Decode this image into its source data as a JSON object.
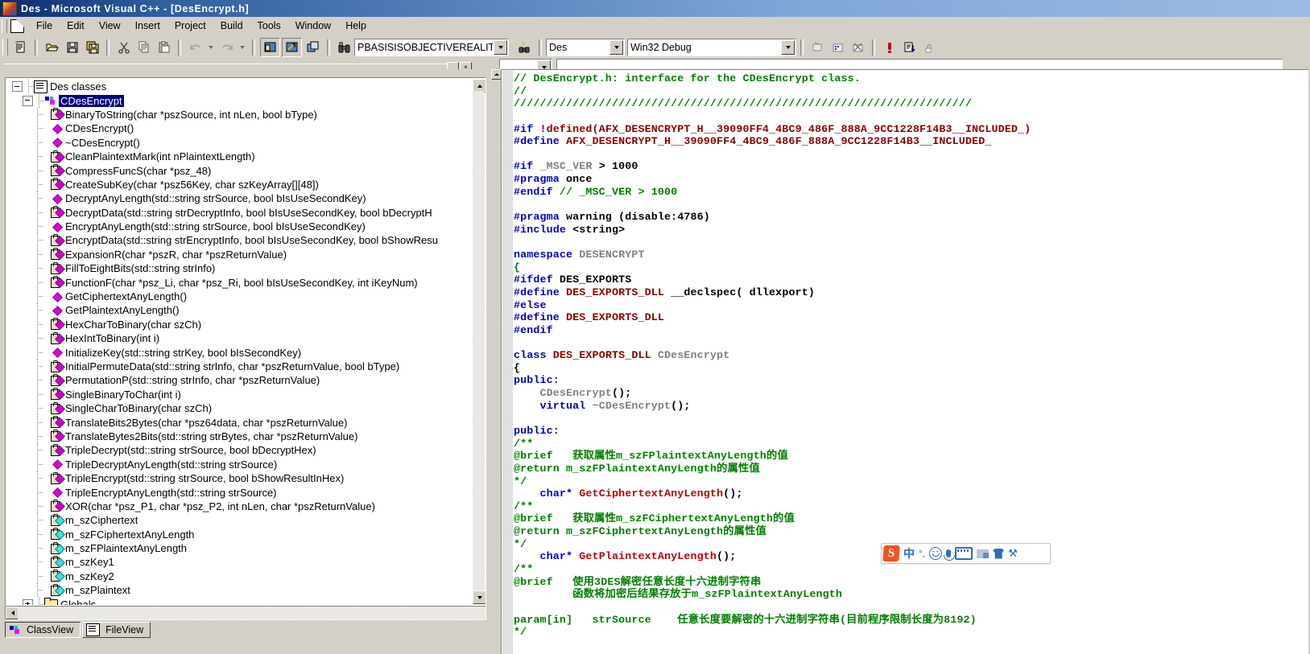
{
  "window": {
    "title": "Des - Microsoft Visual C++ - [DesEncrypt.h]",
    "app_icon": "visual-cpp-icon"
  },
  "menubar": {
    "doc_icon": "document-icon",
    "items": [
      {
        "label": "File"
      },
      {
        "label": "Edit"
      },
      {
        "label": "View"
      },
      {
        "label": "Insert"
      },
      {
        "label": "Project"
      },
      {
        "label": "Build"
      },
      {
        "label": "Tools"
      },
      {
        "label": "Window"
      },
      {
        "label": "Help"
      }
    ]
  },
  "toolbar_standard": {
    "buttons": [
      {
        "name": "new-text-file-icon",
        "title": "New"
      },
      {
        "name": "open-folder-icon",
        "title": "Open"
      },
      {
        "name": "save-icon",
        "title": "Save"
      },
      {
        "name": "save-all-icon",
        "title": "Save All"
      },
      {
        "name": "cut-scissors-icon",
        "title": "Cut"
      },
      {
        "name": "copy-icon",
        "title": "Copy"
      },
      {
        "name": "paste-icon",
        "title": "Paste"
      },
      {
        "name": "undo-icon",
        "title": "Undo"
      },
      {
        "name": "undo-dropdown-icon",
        "title": "Undo list"
      },
      {
        "name": "redo-icon",
        "title": "Redo"
      },
      {
        "name": "redo-dropdown-icon",
        "title": "Redo list"
      },
      {
        "name": "workspace-window-icon",
        "title": "Workspace"
      },
      {
        "name": "output-window-icon",
        "title": "Output"
      },
      {
        "name": "window-list-icon",
        "title": "Windows"
      }
    ],
    "find_icon": "binoculars-icon",
    "find_value": "PBASISISOBJECTIVEREALIT",
    "find_in_files_icon": "find-in-files-icon",
    "project_value": "Des",
    "config_value": "Win32 Debug",
    "build_buttons": [
      {
        "name": "compile-icon",
        "title": "Compile"
      },
      {
        "name": "build-icon",
        "title": "Build"
      },
      {
        "name": "stop-build-icon",
        "title": "Stop Build"
      },
      {
        "name": "execute-program-icon",
        "title": "Execute Program"
      },
      {
        "name": "go-debug-icon",
        "title": "Go"
      },
      {
        "name": "insert-breakpoint-icon",
        "title": "Insert/Remove Breakpoint"
      }
    ]
  },
  "toolbar_wizard": {
    "combo_value": "",
    "search_value": ""
  },
  "pane_buttons": {
    "minimize_label": "_",
    "close_label": "×"
  },
  "classview": {
    "tabs": [
      {
        "label": "ClassView",
        "icon": "classview-icon",
        "active": true
      },
      {
        "label": "FileView",
        "icon": "fileview-icon",
        "active": false
      }
    ],
    "tree": [
      {
        "label": "Des classes",
        "icon": "classes-root-icon",
        "depth": 0,
        "toggle": "minus",
        "selected": false
      },
      {
        "label": "CDesEncrypt",
        "icon": "class-icon",
        "depth": 1,
        "toggle": "minus",
        "selected": true
      },
      {
        "label": "BinaryToString(char *pszSource, int nLen, bool bType)",
        "icon": "protected-method-icon",
        "depth": 2,
        "toggle": "none",
        "selected": false
      },
      {
        "label": "CDesEncrypt()",
        "icon": "public-method-icon",
        "depth": 2,
        "toggle": "none",
        "selected": false
      },
      {
        "label": "~CDesEncrypt()",
        "icon": "public-method-icon",
        "depth": 2,
        "toggle": "none",
        "selected": false
      },
      {
        "label": "CleanPlaintextMark(int nPlaintextLength)",
        "icon": "protected-method-icon",
        "depth": 2,
        "toggle": "none",
        "selected": false
      },
      {
        "label": "CompressFuncS(char *psz_48)",
        "icon": "protected-method-icon",
        "depth": 2,
        "toggle": "none",
        "selected": false
      },
      {
        "label": "CreateSubKey(char *psz56Key, char szKeyArray[][48])",
        "icon": "protected-method-icon",
        "depth": 2,
        "toggle": "none",
        "selected": false
      },
      {
        "label": "DecryptAnyLength(std::string strSource, bool bIsUseSecondKey)",
        "icon": "public-method-icon",
        "depth": 2,
        "toggle": "none",
        "selected": false
      },
      {
        "label": "DecryptData(std::string strDecryptInfo, bool bIsUseSecondKey, bool bDecryptH",
        "icon": "protected-method-icon",
        "depth": 2,
        "toggle": "none",
        "selected": false
      },
      {
        "label": "EncryptAnyLength(std::string strSource, bool bIsUseSecondKey)",
        "icon": "public-method-icon",
        "depth": 2,
        "toggle": "none",
        "selected": false
      },
      {
        "label": "EncryptData(std::string strEncryptInfo, bool bIsUseSecondKey, bool bShowResu",
        "icon": "protected-method-icon",
        "depth": 2,
        "toggle": "none",
        "selected": false
      },
      {
        "label": "ExpansionR(char *pszR, char *pszReturnValue)",
        "icon": "protected-method-icon",
        "depth": 2,
        "toggle": "none",
        "selected": false
      },
      {
        "label": "FillToEightBits(std::string strInfo)",
        "icon": "protected-method-icon",
        "depth": 2,
        "toggle": "none",
        "selected": false
      },
      {
        "label": "FunctionF(char *psz_Li, char *psz_Ri, bool bIsUseSecondKey, int iKeyNum)",
        "icon": "protected-method-icon",
        "depth": 2,
        "toggle": "none",
        "selected": false
      },
      {
        "label": "GetCiphertextAnyLength()",
        "icon": "public-method-icon",
        "depth": 2,
        "toggle": "none",
        "selected": false
      },
      {
        "label": "GetPlaintextAnyLength()",
        "icon": "public-method-icon",
        "depth": 2,
        "toggle": "none",
        "selected": false
      },
      {
        "label": "HexCharToBinary(char szCh)",
        "icon": "protected-method-icon",
        "depth": 2,
        "toggle": "none",
        "selected": false
      },
      {
        "label": "HexIntToBinary(int i)",
        "icon": "protected-method-icon",
        "depth": 2,
        "toggle": "none",
        "selected": false
      },
      {
        "label": "InitializeKey(std::string strKey, bool bIsSecondKey)",
        "icon": "public-method-icon",
        "depth": 2,
        "toggle": "none",
        "selected": false
      },
      {
        "label": "InitialPermuteData(std::string strInfo, char *pszReturnValue, bool bType)",
        "icon": "protected-method-icon",
        "depth": 2,
        "toggle": "none",
        "selected": false
      },
      {
        "label": "PermutationP(std::string strInfo, char *pszReturnValue)",
        "icon": "protected-method-icon",
        "depth": 2,
        "toggle": "none",
        "selected": false
      },
      {
        "label": "SingleBinaryToChar(int i)",
        "icon": "protected-method-icon",
        "depth": 2,
        "toggle": "none",
        "selected": false
      },
      {
        "label": "SingleCharToBinary(char szCh)",
        "icon": "protected-method-icon",
        "depth": 2,
        "toggle": "none",
        "selected": false
      },
      {
        "label": "TranslateBits2Bytes(char *psz64data, char *pszReturnValue)",
        "icon": "protected-method-icon",
        "depth": 2,
        "toggle": "none",
        "selected": false
      },
      {
        "label": "TranslateBytes2Bits(std::string strBytes, char *pszReturnValue)",
        "icon": "protected-method-icon",
        "depth": 2,
        "toggle": "none",
        "selected": false
      },
      {
        "label": "TripleDecrypt(std::string strSource, bool bDecryptHex)",
        "icon": "protected-method-icon",
        "depth": 2,
        "toggle": "none",
        "selected": false
      },
      {
        "label": "TripleDecryptAnyLength(std::string strSource)",
        "icon": "public-method-icon",
        "depth": 2,
        "toggle": "none",
        "selected": false
      },
      {
        "label": "TripleEncrypt(std::string strSource, bool bShowResultInHex)",
        "icon": "protected-method-icon",
        "depth": 2,
        "toggle": "none",
        "selected": false
      },
      {
        "label": "TripleEncryptAnyLength(std::string strSource)",
        "icon": "public-method-icon",
        "depth": 2,
        "toggle": "none",
        "selected": false
      },
      {
        "label": "XOR(char *psz_P1, char *psz_P2, int nLen, char *pszReturnValue)",
        "icon": "protected-method-icon",
        "depth": 2,
        "toggle": "none",
        "selected": false
      },
      {
        "label": "m_szCiphertext",
        "icon": "member-variable-icon",
        "depth": 2,
        "toggle": "none",
        "selected": false
      },
      {
        "label": "m_szFCiphertextAnyLength",
        "icon": "member-variable-icon",
        "depth": 2,
        "toggle": "none",
        "selected": false
      },
      {
        "label": "m_szFPlaintextAnyLength",
        "icon": "member-variable-icon",
        "depth": 2,
        "toggle": "none",
        "selected": false
      },
      {
        "label": "m_szKey1",
        "icon": "member-variable-icon",
        "depth": 2,
        "toggle": "none",
        "selected": false
      },
      {
        "label": "m_szKey2",
        "icon": "member-variable-icon",
        "depth": 2,
        "toggle": "none",
        "selected": false
      },
      {
        "label": "m_szPlaintext",
        "icon": "member-variable-icon",
        "depth": 2,
        "toggle": "none",
        "selected": false
      },
      {
        "label": "Globals",
        "icon": "folder-icon",
        "depth": 1,
        "toggle": "plus",
        "selected": false
      }
    ]
  },
  "editor": {
    "filename": "DesEncrypt.h",
    "lines": [
      [
        {
          "t": "// DesEncrypt.h: interface for the CDesEncrypt class.",
          "c": "c-com"
        }
      ],
      [
        {
          "t": "//",
          "c": "c-com"
        }
      ],
      [
        {
          "t": "//////////////////////////////////////////////////////////////////////",
          "c": "c-com"
        }
      ],
      [],
      [
        {
          "t": "#if",
          "c": "c-pre"
        },
        {
          "t": " !defined(AFX_DESENCRYPT_H__39090FF4_4BC9_486F_888A_9CC1228F14B3__INCLUDED_)",
          "c": "c-def"
        }
      ],
      [
        {
          "t": "#define",
          "c": "c-pre"
        },
        {
          "t": " AFX_DESENCRYPT_H__39090FF4_4BC9_486F_888A_9CC1228F14B3__INCLUDED_",
          "c": "c-def"
        }
      ],
      [],
      [
        {
          "t": "#if",
          "c": "c-pre"
        },
        {
          "t": " _MSC_VER",
          "c": "c-id"
        },
        {
          "t": " > ",
          "c": "c-blk"
        },
        {
          "t": "1000",
          "c": "c-num"
        }
      ],
      [
        {
          "t": "#pragma",
          "c": "c-pre"
        },
        {
          "t": " once",
          "c": "c-blk"
        }
      ],
      [
        {
          "t": "#endif",
          "c": "c-pre"
        },
        {
          "t": " // _MSC_VER > 1000",
          "c": "c-com"
        }
      ],
      [],
      [
        {
          "t": "#pragma",
          "c": "c-pre"
        },
        {
          "t": " warning (disable:4786)",
          "c": "c-blk"
        }
      ],
      [
        {
          "t": "#include",
          "c": "c-pre"
        },
        {
          "t": " <string>",
          "c": "c-blk"
        }
      ],
      [],
      [
        {
          "t": "namespace",
          "c": "c-kw"
        },
        {
          "t": " DESENCRYPT",
          "c": "c-id"
        }
      ],
      [
        {
          "t": "{",
          "c": "c-com"
        }
      ],
      [
        {
          "t": "#ifdef",
          "c": "c-pre"
        },
        {
          "t": " DES_EXPORTS",
          "c": "c-blk"
        }
      ],
      [
        {
          "t": "#define",
          "c": "c-pre"
        },
        {
          "t": " DES_EXPORTS_DLL",
          "c": "c-def"
        },
        {
          "t": " __declspec( dllexport)",
          "c": "c-blk"
        }
      ],
      [
        {
          "t": "#else",
          "c": "c-pre"
        }
      ],
      [
        {
          "t": "#define",
          "c": "c-pre"
        },
        {
          "t": " DES_EXPORTS_DLL",
          "c": "c-def"
        }
      ],
      [
        {
          "t": "#endif",
          "c": "c-pre"
        }
      ],
      [],
      [
        {
          "t": "class",
          "c": "c-kw"
        },
        {
          "t": " DES_EXPORTS_DLL",
          "c": "c-def"
        },
        {
          "t": " CDesEncrypt",
          "c": "c-id"
        }
      ],
      [
        {
          "t": "{",
          "c": "c-blk"
        }
      ],
      [
        {
          "t": "public:",
          "c": "c-kw"
        }
      ],
      [
        {
          "t": "    CDesEncrypt",
          "c": "c-id"
        },
        {
          "t": "();",
          "c": "c-blk"
        }
      ],
      [
        {
          "t": "    virtual",
          "c": "c-kw"
        },
        {
          "t": " ~CDesEncrypt",
          "c": "c-id"
        },
        {
          "t": "();",
          "c": "c-blk"
        }
      ],
      [],
      [
        {
          "t": "public:",
          "c": "c-kw"
        }
      ],
      [
        {
          "t": "/**",
          "c": "c-com"
        }
      ],
      [
        {
          "t": "@brief   获取属性m_szFPlaintextAnyLength的值",
          "c": "c-com"
        }
      ],
      [
        {
          "t": "@return m_szFPlaintextAnyLength的属性值",
          "c": "c-com"
        }
      ],
      [
        {
          "t": "*/",
          "c": "c-com"
        }
      ],
      [
        {
          "t": "    char*",
          "c": "c-kw"
        },
        {
          "t": " GetCiphertextAnyLength",
          "c": "c-fn"
        },
        {
          "t": "();",
          "c": "c-blk"
        }
      ],
      [
        {
          "t": "/**",
          "c": "c-com"
        }
      ],
      [
        {
          "t": "@brief   获取属性m_szFCiphertextAnyLength的值",
          "c": "c-com"
        }
      ],
      [
        {
          "t": "@return m_szFCiphertextAnyLength的属性值",
          "c": "c-com"
        }
      ],
      [
        {
          "t": "*/",
          "c": "c-com"
        }
      ],
      [
        {
          "t": "    char*",
          "c": "c-kw"
        },
        {
          "t": " GetPlaintextAnyLength",
          "c": "c-fn"
        },
        {
          "t": "();",
          "c": "c-blk"
        }
      ],
      [
        {
          "t": "/**",
          "c": "c-com"
        }
      ],
      [
        {
          "t": "@brief   使用3DES解密任意长度十六进制字符串",
          "c": "c-com"
        }
      ],
      [
        {
          "t": "         函数将加密后结果存放于m_szFPlaintextAnyLength",
          "c": "c-com"
        }
      ],
      [],
      [
        {
          "t": "param[in]   strSource    任意长度要解密的十六进制字符串(目前程序限制长度为8192)",
          "c": "c-com"
        }
      ],
      [
        {
          "t": "*/",
          "c": "c-com"
        }
      ]
    ]
  },
  "ime": {
    "name": "sogou-input-method",
    "logo_label": "S",
    "items": [
      {
        "name": "chinese-mode-icon",
        "label": "中"
      },
      {
        "name": "punctuation-mode-icon",
        "label": "°,"
      },
      {
        "name": "emoji-icon",
        "label": ""
      },
      {
        "name": "voice-input-icon",
        "label": ""
      },
      {
        "name": "soft-keyboard-icon",
        "label": ""
      },
      {
        "name": "user-card-icon",
        "label": ""
      },
      {
        "name": "skin-shirt-icon",
        "label": ""
      },
      {
        "name": "toolbox-icon",
        "label": "⚒"
      }
    ]
  },
  "colors": {
    "title_bar": "#3a6ea5",
    "chrome": "#d4d0c8",
    "comment_green": "#008000",
    "preprocessor_blue": "#0000c0",
    "define_maroon": "#8b0000",
    "identifier_gray": "#808080",
    "function_red": "#c00000",
    "selection_navy": "#000080",
    "ime_orange": "#f4511e",
    "ime_blue": "#2a6ebb"
  }
}
